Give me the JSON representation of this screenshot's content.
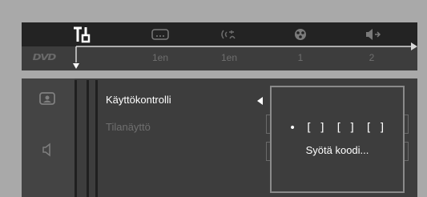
{
  "topbar": {
    "disc_badge": "DVD",
    "icons": [
      {
        "name": "setup-tools-icon",
        "state": "selected"
      },
      {
        "name": "subtitle-icon"
      },
      {
        "name": "audio-language-icon"
      },
      {
        "name": "angle-icon"
      },
      {
        "name": "speaker-icon"
      }
    ],
    "values": [
      "1en",
      "1en",
      "1",
      "2"
    ]
  },
  "sidebar": {
    "icons": [
      "screen-settings-icon",
      "sound-settings-icon"
    ]
  },
  "menu": {
    "items": [
      {
        "label": "Käyttökontrolli",
        "state": "active"
      },
      {
        "label": "Tilanäyttö",
        "state": "inactive"
      }
    ]
  },
  "code_entry": {
    "slots": [
      {
        "type": "dot",
        "text": "•"
      },
      {
        "type": "bracket",
        "text": "[ ]"
      },
      {
        "type": "bracket",
        "text": "[ ]"
      },
      {
        "type": "bracket",
        "text": "[ ]"
      }
    ],
    "prompt": "Syötä koodi..."
  },
  "colors": {
    "background": "#a9a9a9",
    "panel": "#3d3d3d",
    "strip": "#232323",
    "text_active": "#ffffff",
    "text_dim": "#6f6f6f"
  }
}
